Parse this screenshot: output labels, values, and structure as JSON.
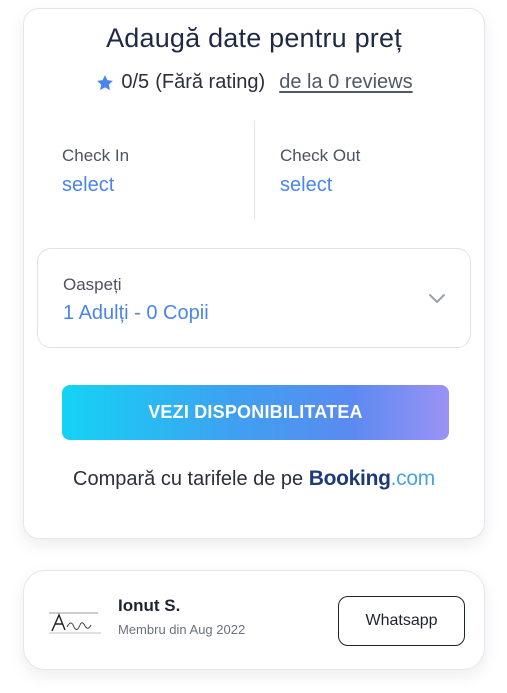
{
  "booking": {
    "title": "Adaugă date pentru preț",
    "rating": {
      "score": "0/5",
      "label": "(Fără rating)",
      "reviews_link": "de la 0 reviews"
    },
    "check_in": {
      "label": "Check In",
      "value": "select"
    },
    "check_out": {
      "label": "Check Out",
      "value": "select"
    },
    "guests": {
      "label": "Oaspeți",
      "value": "1 Adulți - 0 Copii"
    },
    "cta_label": "VEZI DISPONIBILITATEA",
    "compare": {
      "text": "Compară cu tarifele de pe",
      "brand_main": "Booking",
      "brand_tld": ".com"
    }
  },
  "host": {
    "name": "Ionut S.",
    "member_since": "Membru din Aug 2022",
    "whatsapp_label": "Whatsapp"
  },
  "colors": {
    "accent_blue": "#4a86e8",
    "cta_gradient_start": "#14d3f5",
    "cta_gradient_end": "#9b92f5",
    "booking_brand": "#1c3b7a"
  },
  "icons": [
    "star-icon",
    "chevron-down-icon",
    "avatar-signature-icon"
  ]
}
